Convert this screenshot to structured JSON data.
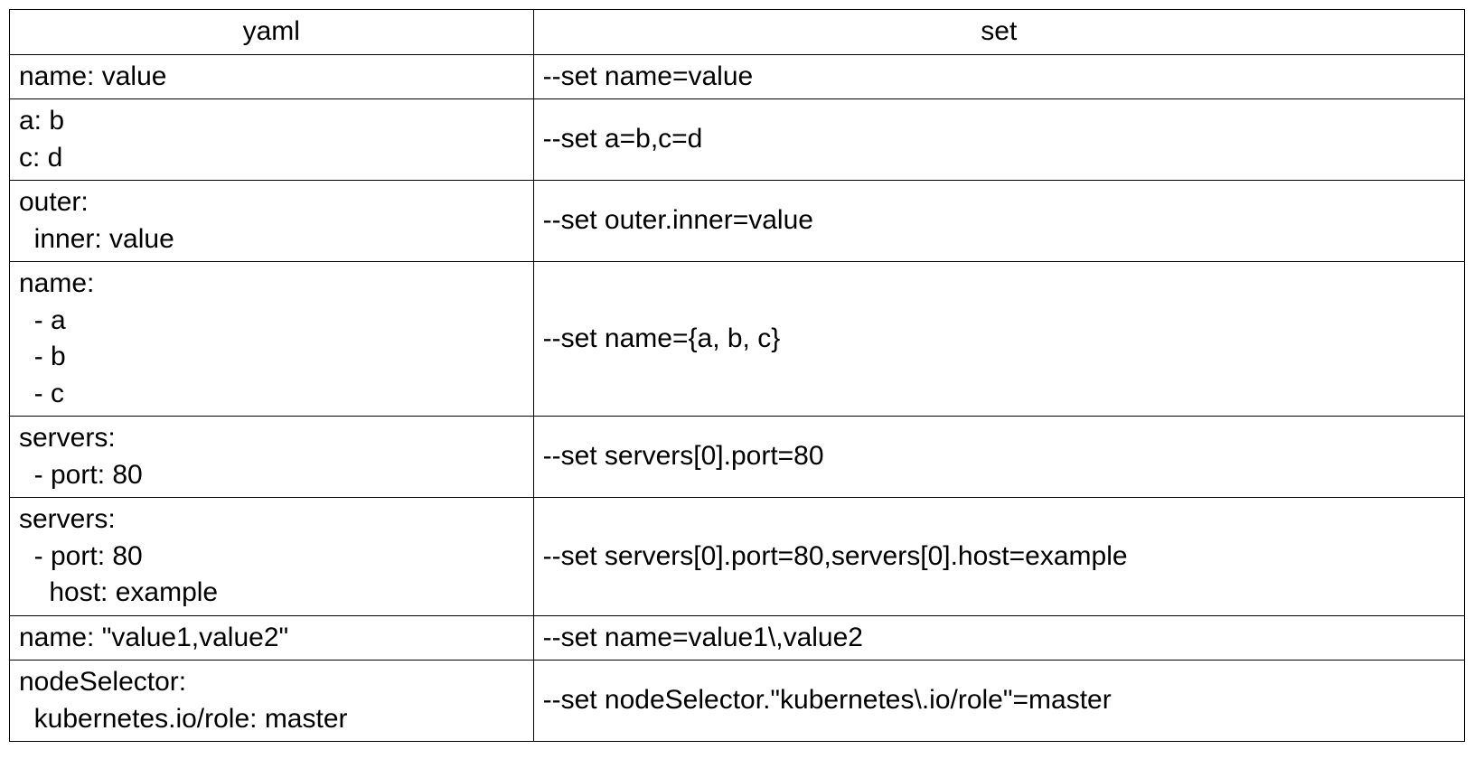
{
  "table": {
    "headers": {
      "yaml": "yaml",
      "set": "set"
    },
    "rows": [
      {
        "yaml": "name: value",
        "set": "--set name=value"
      },
      {
        "yaml": "a: b\nc: d",
        "set": "--set a=b,c=d"
      },
      {
        "yaml": "outer:\n  inner: value",
        "set": "--set outer.inner=value"
      },
      {
        "yaml": "name:\n  - a\n  - b\n  - c",
        "set": "--set name={a, b, c}"
      },
      {
        "yaml": "servers:\n  - port: 80",
        "set": "--set servers[0].port=80"
      },
      {
        "yaml": "servers:\n  - port: 80\n    host: example",
        "set": "--set servers[0].port=80,servers[0].host=example"
      },
      {
        "yaml": "name: \"value1,value2\"",
        "set": "--set name=value1\\,value2"
      },
      {
        "yaml": "nodeSelector:\n  kubernetes.io/role: master",
        "set": "--set nodeSelector.\"kubernetes\\.io/role\"=master"
      }
    ]
  }
}
